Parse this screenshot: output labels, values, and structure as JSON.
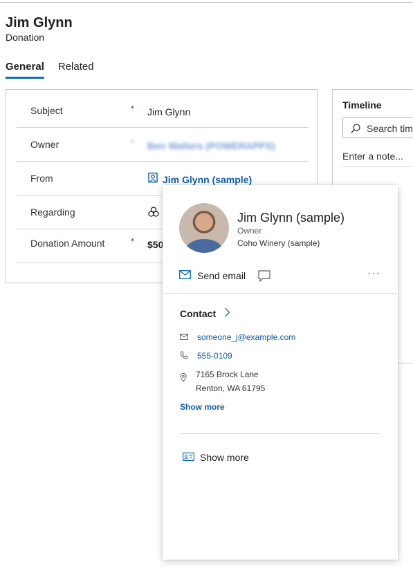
{
  "record": {
    "title": "Jim Glynn",
    "subtitle": "Donation"
  },
  "tabs": [
    {
      "label": "General",
      "active": true
    },
    {
      "label": "Related",
      "active": false
    }
  ],
  "form": {
    "fields": [
      {
        "label": "Subject",
        "required": "*",
        "value": "Jim Glynn"
      },
      {
        "label": "Owner",
        "required": "*",
        "value": "Ben Walters (POWERAPPS)"
      },
      {
        "label": "From",
        "required": "",
        "value": "Jim Glynn (sample)"
      },
      {
        "label": "Regarding",
        "required": "",
        "value": ""
      },
      {
        "label": "Donation Amount",
        "required": "*",
        "value": "$50"
      }
    ]
  },
  "timeline": {
    "title": "Timeline",
    "search_placeholder": "Search timeline",
    "note_placeholder": "Enter a note..."
  },
  "contact_card": {
    "name": "Jim Glynn (sample)",
    "role": "Owner",
    "company": "Coho Winery (sample)",
    "send_email": "Send email",
    "more": "···",
    "section_title": "Contact",
    "email": "someone_j@example.com",
    "phone": "555-0109",
    "address_line1": "7165 Brock Lane",
    "address_line2": "Renton, WA 61795",
    "show_more_link": "Show more",
    "show_more_footer": "Show more"
  },
  "colors": {
    "accent": "#0f6cbd",
    "link": "#0f5aa8",
    "required": "#a4262c"
  }
}
